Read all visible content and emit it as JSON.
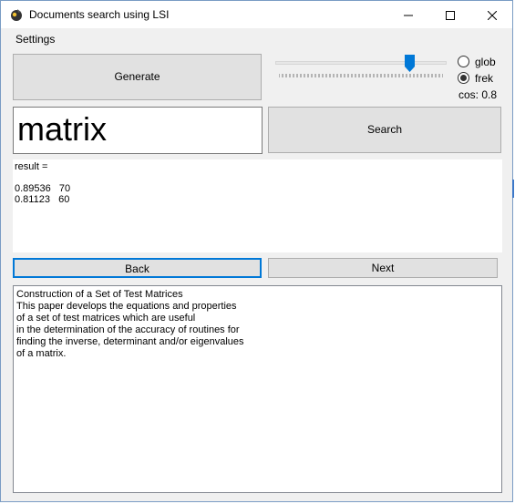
{
  "window": {
    "title": "Documents search using LSI",
    "min_icon": "minimize-icon",
    "max_icon": "maximize-icon",
    "close_icon": "close-icon"
  },
  "menu": {
    "items": [
      "Settings"
    ]
  },
  "toolbar": {
    "generate_label": "Generate",
    "search_label": "Search"
  },
  "slider": {
    "level": 0.75
  },
  "options": {
    "glob_label": "glob",
    "frek_label": "frek",
    "selected": "frek",
    "cos_label": "cos: 0.8"
  },
  "query": {
    "value": "matrix"
  },
  "results": {
    "text": "result =\n\n0.89536   70\n0.81123   60"
  },
  "nav": {
    "back_label": "Back",
    "next_label": "Next"
  },
  "document": {
    "lines": [
      "Construction of a Set of Test Matrices",
      "This paper develops the equations and properties",
      "of a set of test matrices which are useful",
      "in the determination of the accuracy of routines for",
      "finding the inverse, determinant and/or eigenvalues",
      "of a matrix."
    ]
  },
  "colors": {
    "accent": "#0078d7",
    "focus_border": "#0078d7"
  }
}
